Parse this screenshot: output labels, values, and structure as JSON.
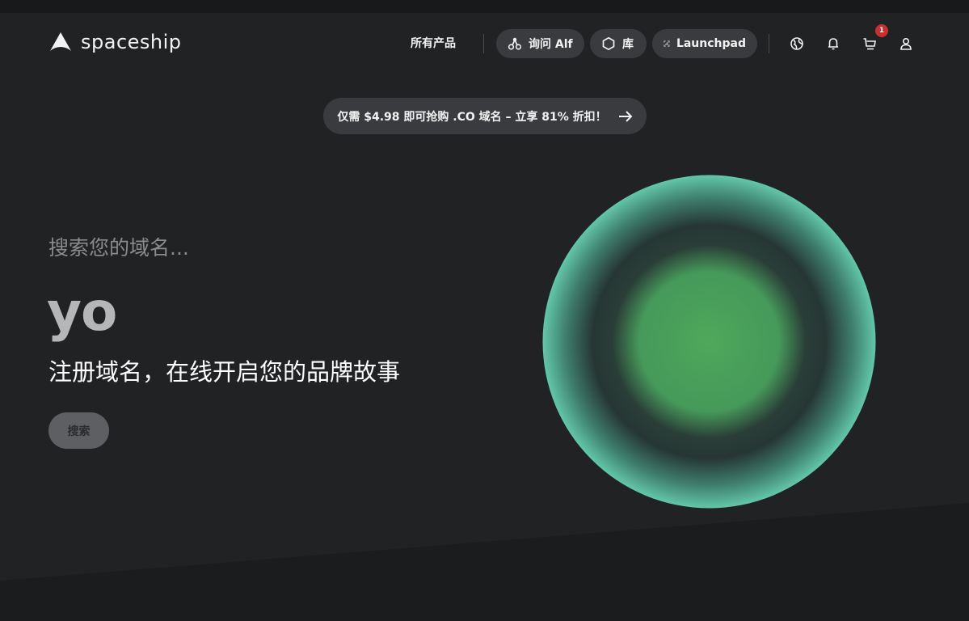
{
  "brand": {
    "name": "spaceship"
  },
  "nav": {
    "all_products": "所有产品",
    "ask_alf": "询问 Alf",
    "library": "库",
    "launchpad": "Launchpad",
    "cart_count": "1"
  },
  "promo": {
    "text": "仅需 $4.98 即可抢购 .CO 域名 – 立享 81% 折扣！"
  },
  "hero": {
    "search_prompt": "搜索您的域名...",
    "typed_value": "yo",
    "tagline": "注册域名，在线开启您的品牌故事",
    "search_button": "搜索"
  },
  "icons": [
    "spaceship-logo-icon",
    "alf-icon",
    "hexagon-icon",
    "launchpad-icon",
    "globe-icon",
    "bell-icon",
    "cart-icon",
    "user-icon",
    "arrow-right-icon"
  ],
  "colors": {
    "background": "#212224",
    "pill": "#3a3b3e",
    "badge": "#c8302c",
    "orb_outer": "#5fc4a8",
    "orb_inner": "#4fa85a"
  }
}
